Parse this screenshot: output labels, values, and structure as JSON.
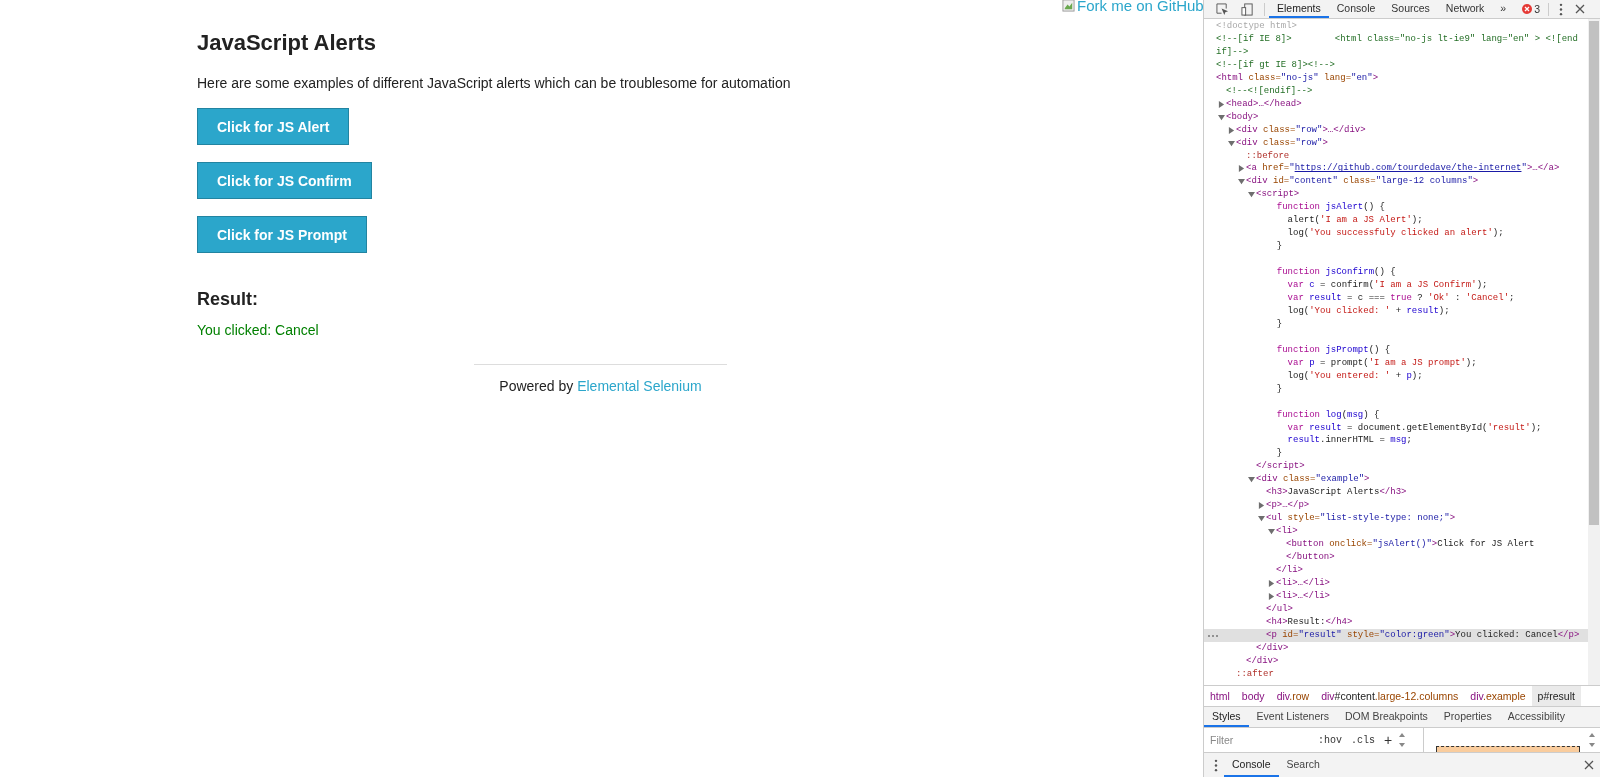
{
  "page": {
    "fork_link": "Fork me on GitHub",
    "heading": "JavaScript Alerts",
    "intro": "Here are some examples of different JavaScript alerts which can be troublesome for automation",
    "buttons": [
      "Click for JS Alert",
      "Click for JS Confirm",
      "Click for JS Prompt"
    ],
    "result_heading": "Result:",
    "result_text": "You clicked: Cancel",
    "footer": {
      "text": "Powered by",
      "link": "Elemental Selenium"
    }
  },
  "devtools": {
    "tabs": [
      {
        "label": "Elements",
        "selected": true
      },
      {
        "label": "Console",
        "selected": false
      },
      {
        "label": "Sources",
        "selected": false
      },
      {
        "label": "Network",
        "selected": false
      }
    ],
    "more": "»",
    "error_count": "3",
    "dom": [
      {
        "selected": false,
        "tokens": [
          {
            "kind": "doctype",
            "text": "<!doctype html>"
          }
        ]
      },
      {
        "selected": false,
        "tokens": [
          {
            "kind": "comment",
            "text": "<!--[if IE 8]>        <html class=\"no-js lt-ie9\" lang=\"en\" > <![endif]-->"
          }
        ]
      },
      {
        "selected": false,
        "tokens": [
          {
            "kind": "comment",
            "text": "<!--[if gt IE 8]><!-->"
          }
        ]
      },
      {
        "selected": false,
        "tokens": [
          {
            "kind": "tag",
            "text": "<html"
          },
          {
            "kind": "attr",
            "text": " class="
          },
          {
            "kind": "val",
            "text": "\"no-js\""
          },
          {
            "kind": "attr",
            "text": " lang="
          },
          {
            "kind": "val",
            "text": "\"en\""
          },
          {
            "kind": "tag",
            "text": ">"
          }
        ],
        "children": [
          {
            "selected": false,
            "tokens": [
              {
                "kind": "comment",
                "text": "<!--<![endif]-->"
              }
            ]
          },
          {
            "selected": false,
            "expanded": false,
            "tokens": [
              {
                "kind": "tag",
                "text": "<head>…</head>"
              }
            ]
          },
          {
            "selected": false,
            "expanded": true,
            "tokens": [
              {
                "kind": "tag",
                "text": "<body>"
              }
            ],
            "children": [
              {
                "selected": false,
                "expanded": false,
                "tokens": [
                  {
                    "kind": "tag",
                    "text": "<div"
                  },
                  {
                    "kind": "attr",
                    "text": " class="
                  },
                  {
                    "kind": "val",
                    "text": "\"row\""
                  },
                  {
                    "kind": "tag",
                    "text": ">…</div>"
                  }
                ]
              },
              {
                "selected": false,
                "expanded": true,
                "tokens": [
                  {
                    "kind": "tag",
                    "text": "<div"
                  },
                  {
                    "kind": "attr",
                    "text": " class="
                  },
                  {
                    "kind": "val",
                    "text": "\"row\""
                  },
                  {
                    "kind": "tag",
                    "text": ">"
                  }
                ],
                "close": [
                  {
                    "kind": "pseudo",
                    "text": "::after"
                  }
                ],
                "children": [
                  {
                    "selected": false,
                    "tokens": [
                      {
                        "kind": "pseudo",
                        "text": "::before"
                      }
                    ]
                  },
                  {
                    "selected": false,
                    "expanded": false,
                    "tokens": [
                      {
                        "kind": "tag",
                        "text": "<a"
                      },
                      {
                        "kind": "attr",
                        "text": " href="
                      },
                      {
                        "kind": "val",
                        "text": "\""
                      },
                      {
                        "kind": "link",
                        "text": "https://github.com/tourdedave/the-internet"
                      },
                      {
                        "kind": "val",
                        "text": "\""
                      },
                      {
                        "kind": "tag",
                        "text": ">…</a>"
                      }
                    ]
                  },
                  {
                    "selected": false,
                    "expanded": true,
                    "tokens": [
                      {
                        "kind": "tag",
                        "text": "<div"
                      },
                      {
                        "kind": "attr",
                        "text": " id="
                      },
                      {
                        "kind": "val",
                        "text": "\"content\""
                      },
                      {
                        "kind": "attr",
                        "text": " class="
                      },
                      {
                        "kind": "val",
                        "text": "\"large-12 columns\""
                      },
                      {
                        "kind": "tag",
                        "text": ">"
                      }
                    ],
                    "close": [
                      {
                        "kind": "tag",
                        "text": "</div>"
                      }
                    ],
                    "children": [
                      {
                        "selected": false,
                        "expanded": true,
                        "tokens": [
                          {
                            "kind": "tag",
                            "text": "<script>"
                          }
                        ],
                        "close": [
                          {
                            "kind": "tag",
                            "text": "</script>"
                          }
                        ],
                        "children": [
                          {
                            "selected": false,
                            "tokens": [
                              {
                                "kind": "kw",
                                "text": "  function "
                              },
                              {
                                "kind": "ident",
                                "text": "jsAlert"
                              },
                              {
                                "kind": "plain",
                                "text": "() {"
                              }
                            ]
                          },
                          {
                            "selected": false,
                            "tokens": [
                              {
                                "kind": "plain",
                                "text": "    alert("
                              },
                              {
                                "kind": "str",
                                "text": "'I am a JS Alert'"
                              },
                              {
                                "kind": "plain",
                                "text": ");"
                              }
                            ]
                          },
                          {
                            "selected": false,
                            "tokens": [
                              {
                                "kind": "plain",
                                "text": "    log("
                              },
                              {
                                "kind": "str",
                                "text": "'You successfuly clicked an alert'"
                              },
                              {
                                "kind": "plain",
                                "text": ");"
                              }
                            ]
                          },
                          {
                            "selected": false,
                            "tokens": [
                              {
                                "kind": "plain",
                                "text": "  }"
                              }
                            ]
                          },
                          {
                            "selected": false
                          },
                          {
                            "selected": false,
                            "tokens": [
                              {
                                "kind": "kw",
                                "text": "  function "
                              },
                              {
                                "kind": "ident",
                                "text": "jsConfirm"
                              },
                              {
                                "kind": "plain",
                                "text": "() {"
                              }
                            ]
                          },
                          {
                            "selected": false,
                            "tokens": [
                              {
                                "kind": "kw",
                                "text": "    var"
                              },
                              {
                                "kind": "ident",
                                "text": " c"
                              },
                              {
                                "kind": "plain",
                                "text": " = confirm("
                              },
                              {
                                "kind": "str",
                                "text": "'I am a JS Confirm'"
                              },
                              {
                                "kind": "plain",
                                "text": ");"
                              }
                            ]
                          },
                          {
                            "selected": false,
                            "tokens": [
                              {
                                "kind": "kw",
                                "text": "    var"
                              },
                              {
                                "kind": "ident",
                                "text": " result"
                              },
                              {
                                "kind": "plain",
                                "text": " = c === "
                              },
                              {
                                "kind": "kw",
                                "text": "true"
                              },
                              {
                                "kind": "plain",
                                "text": " ? "
                              },
                              {
                                "kind": "str",
                                "text": "'Ok'"
                              },
                              {
                                "kind": "plain",
                                "text": " : "
                              },
                              {
                                "kind": "str",
                                "text": "'Cancel'"
                              },
                              {
                                "kind": "plain",
                                "text": ";"
                              }
                            ]
                          },
                          {
                            "selected": false,
                            "tokens": [
                              {
                                "kind": "plain",
                                "text": "    log("
                              },
                              {
                                "kind": "str",
                                "text": "'You clicked: '"
                              },
                              {
                                "kind": "plain",
                                "text": " + "
                              },
                              {
                                "kind": "ident",
                                "text": "result"
                              },
                              {
                                "kind": "plain",
                                "text": ");"
                              }
                            ]
                          },
                          {
                            "selected": false,
                            "tokens": [
                              {
                                "kind": "plain",
                                "text": "  }"
                              }
                            ]
                          },
                          {
                            "selected": false
                          },
                          {
                            "selected": false,
                            "tokens": [
                              {
                                "kind": "kw",
                                "text": "  function "
                              },
                              {
                                "kind": "ident",
                                "text": "jsPrompt"
                              },
                              {
                                "kind": "plain",
                                "text": "() {"
                              }
                            ]
                          },
                          {
                            "selected": false,
                            "tokens": [
                              {
                                "kind": "kw",
                                "text": "    var"
                              },
                              {
                                "kind": "ident",
                                "text": " p"
                              },
                              {
                                "kind": "plain",
                                "text": " = prompt("
                              },
                              {
                                "kind": "str",
                                "text": "'I am a JS prompt'"
                              },
                              {
                                "kind": "plain",
                                "text": ");"
                              }
                            ]
                          },
                          {
                            "selected": false,
                            "tokens": [
                              {
                                "kind": "plain",
                                "text": "    log("
                              },
                              {
                                "kind": "str",
                                "text": "'You entered: '"
                              },
                              {
                                "kind": "plain",
                                "text": " + "
                              },
                              {
                                "kind": "ident",
                                "text": "p"
                              },
                              {
                                "kind": "plain",
                                "text": ");"
                              }
                            ]
                          },
                          {
                            "selected": false,
                            "tokens": [
                              {
                                "kind": "plain",
                                "text": "  }"
                              }
                            ]
                          },
                          {
                            "selected": false
                          },
                          {
                            "selected": false,
                            "tokens": [
                              {
                                "kind": "kw",
                                "text": "  function "
                              },
                              {
                                "kind": "ident",
                                "text": "log"
                              },
                              {
                                "kind": "plain",
                                "text": "("
                              },
                              {
                                "kind": "ident",
                                "text": "msg"
                              },
                              {
                                "kind": "plain",
                                "text": ") {"
                              }
                            ]
                          },
                          {
                            "selected": false,
                            "tokens": [
                              {
                                "kind": "kw",
                                "text": "    var"
                              },
                              {
                                "kind": "ident",
                                "text": " result"
                              },
                              {
                                "kind": "plain",
                                "text": " = document.getElementById("
                              },
                              {
                                "kind": "str",
                                "text": "'result'"
                              },
                              {
                                "kind": "plain",
                                "text": ");"
                              }
                            ]
                          },
                          {
                            "selected": false,
                            "tokens": [
                              {
                                "kind": "ident",
                                "text": "    result"
                              },
                              {
                                "kind": "plain",
                                "text": ".innerHTML = "
                              },
                              {
                                "kind": "ident",
                                "text": "msg"
                              },
                              {
                                "kind": "plain",
                                "text": ";"
                              }
                            ]
                          },
                          {
                            "selected": false,
                            "tokens": [
                              {
                                "kind": "plain",
                                "text": "  }"
                              }
                            ]
                          }
                        ]
                      },
                      {
                        "selected": false,
                        "expanded": true,
                        "tokens": [
                          {
                            "kind": "tag",
                            "text": "<div"
                          },
                          {
                            "kind": "attr",
                            "text": " class="
                          },
                          {
                            "kind": "val",
                            "text": "\"example\""
                          },
                          {
                            "kind": "tag",
                            "text": ">"
                          }
                        ],
                        "close": [
                          {
                            "kind": "tag",
                            "text": "</div>"
                          }
                        ],
                        "children": [
                          {
                            "selected": false,
                            "tokens": [
                              {
                                "kind": "tag",
                                "text": "<h3>"
                              },
                              {
                                "kind": "plain",
                                "text": "JavaScript Alerts"
                              },
                              {
                                "kind": "tag",
                                "text": "</h3>"
                              }
                            ]
                          },
                          {
                            "selected": false,
                            "expanded": false,
                            "tokens": [
                              {
                                "kind": "tag",
                                "text": "<p>…</p>"
                              }
                            ]
                          },
                          {
                            "selected": false,
                            "expanded": true,
                            "tokens": [
                              {
                                "kind": "tag",
                                "text": "<ul"
                              },
                              {
                                "kind": "attr",
                                "text": " style="
                              },
                              {
                                "kind": "val",
                                "text": "\"list-style-type: none;\""
                              },
                              {
                                "kind": "tag",
                                "text": ">"
                              }
                            ],
                            "close": [
                              {
                                "kind": "tag",
                                "text": "</ul>"
                              }
                            ],
                            "children": [
                              {
                                "selected": false,
                                "expanded": true,
                                "tokens": [
                                  {
                                    "kind": "tag",
                                    "text": "<li>"
                                  }
                                ],
                                "close": [
                                  {
                                    "kind": "tag",
                                    "text": "</li>"
                                  }
                                ],
                                "children": [
                                  {
                                    "selected": false,
                                    "tokens": [
                                      {
                                        "kind": "tag",
                                        "text": "<button"
                                      },
                                      {
                                        "kind": "attr",
                                        "text": " onclick="
                                      },
                                      {
                                        "kind": "val",
                                        "text": "\"jsAlert()\""
                                      },
                                      {
                                        "kind": "tag",
                                        "text": ">"
                                      },
                                      {
                                        "kind": "plain",
                                        "text": "Click for JS Alert"
                                      }
                                    ],
                                    "close": [
                                      {
                                        "kind": "tag",
                                        "text": "</button>"
                                      }
                                    ]
                                  }
                                ]
                              },
                              {
                                "selected": false,
                                "expanded": false,
                                "tokens": [
                                  {
                                    "kind": "tag",
                                    "text": "<li>…</li>"
                                  }
                                ]
                              },
                              {
                                "selected": false,
                                "expanded": false,
                                "tokens": [
                                  {
                                    "kind": "tag",
                                    "text": "<li>…</li>"
                                  }
                                ]
                              }
                            ]
                          },
                          {
                            "selected": false,
                            "tokens": [
                              {
                                "kind": "tag",
                                "text": "<h4>"
                              },
                              {
                                "kind": "plain",
                                "text": "Result:"
                              },
                              {
                                "kind": "tag",
                                "text": "</h4>"
                              }
                            ]
                          },
                          {
                            "selected": true,
                            "tokens": [
                              {
                                "kind": "tag",
                                "text": "<p"
                              },
                              {
                                "kind": "attr",
                                "text": " id="
                              },
                              {
                                "kind": "val",
                                "text": "\"result\""
                              },
                              {
                                "kind": "attr",
                                "text": " style="
                              },
                              {
                                "kind": "val",
                                "text": "\"color:green\""
                              },
                              {
                                "kind": "tag",
                                "text": ">"
                              },
                              {
                                "kind": "plain",
                                "text": "You clicked: Cancel"
                              },
                              {
                                "kind": "tag",
                                "text": "</p>"
                              }
                            ]
                          }
                        ]
                      }
                    ]
                  }
                ]
              }
            ]
          }
        ]
      }
    ],
    "breadcrumbs": [
      {
        "selected": false,
        "parts": [
          {
            "kind": "tag",
            "text": "html"
          }
        ]
      },
      {
        "selected": false,
        "parts": [
          {
            "kind": "tag",
            "text": "body"
          }
        ]
      },
      {
        "selected": false,
        "parts": [
          {
            "kind": "tag",
            "text": "div"
          },
          {
            "kind": "cls",
            "text": ".row"
          }
        ]
      },
      {
        "selected": false,
        "parts": [
          {
            "kind": "tag",
            "text": "div"
          },
          {
            "kind": "id",
            "text": "#content"
          },
          {
            "kind": "cls",
            "text": ".large-12.columns"
          }
        ]
      },
      {
        "selected": false,
        "parts": [
          {
            "kind": "tag",
            "text": "div"
          },
          {
            "kind": "cls",
            "text": ".example"
          }
        ]
      },
      {
        "selected": true,
        "parts": [
          {
            "kind": "id",
            "text": "p#result"
          }
        ]
      }
    ],
    "panel_tabs": [
      {
        "label": "Styles",
        "selected": true
      },
      {
        "label": "Event Listeners",
        "selected": false
      },
      {
        "label": "DOM Breakpoints",
        "selected": false
      },
      {
        "label": "Properties",
        "selected": false
      },
      {
        "label": "Accessibility",
        "selected": false
      }
    ],
    "filter": {
      "placeholder": "Filter"
    },
    "hov": ":hov",
    "cls": ".cls",
    "add": "+",
    "drawer_tabs": [
      {
        "label": "Console",
        "selected": true
      },
      {
        "label": "Search",
        "selected": false
      }
    ]
  }
}
